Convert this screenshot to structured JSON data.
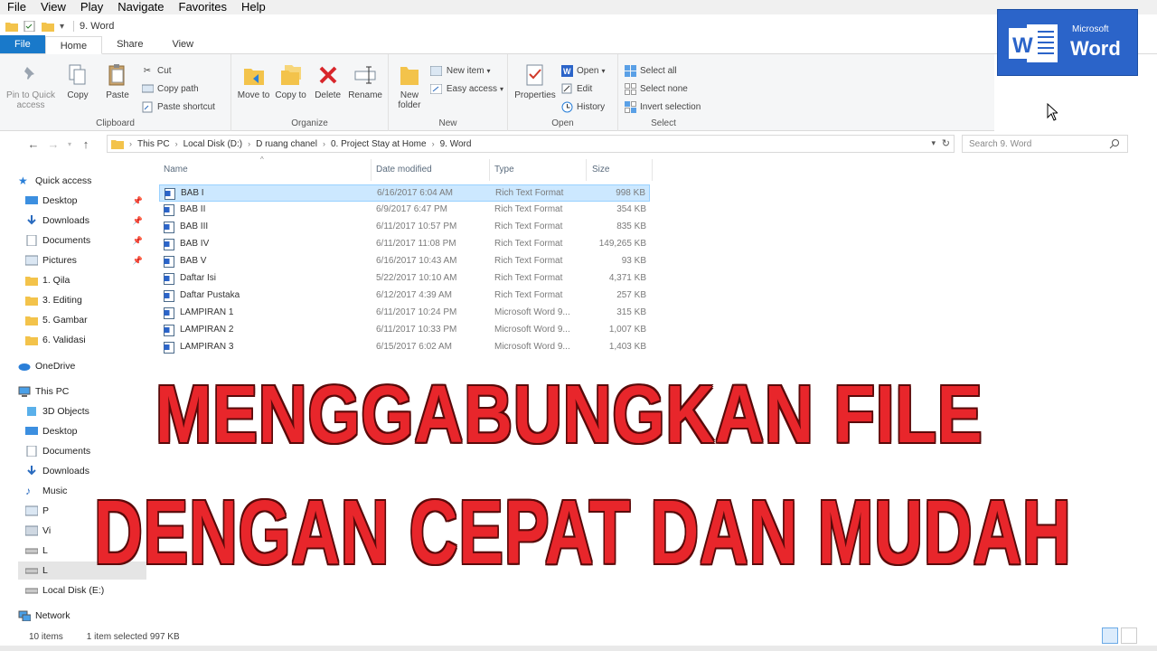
{
  "menubar": [
    "File",
    "View",
    "Play",
    "Navigate",
    "Favorites",
    "Help"
  ],
  "window_title": "9. Word",
  "tabs": [
    {
      "label": "File"
    },
    {
      "label": "Home"
    },
    {
      "label": "Share"
    },
    {
      "label": "View"
    }
  ],
  "ribbon": {
    "clipboard": {
      "label": "Clipboard",
      "pin": "Pin to Quick access",
      "copy": "Copy",
      "paste": "Paste",
      "cut": "Cut",
      "copy_path": "Copy path",
      "paste_shortcut": "Paste shortcut"
    },
    "organize": {
      "label": "Organize",
      "move_to": "Move to",
      "copy_to": "Copy to",
      "delete": "Delete",
      "rename": "Rename"
    },
    "new": {
      "label": "New",
      "new_folder": "New folder",
      "new_item": "New item",
      "easy_access": "Easy access"
    },
    "open": {
      "label": "Open",
      "properties": "Properties",
      "open": "Open",
      "edit": "Edit",
      "history": "History"
    },
    "select": {
      "label": "Select",
      "select_all": "Select all",
      "select_none": "Select none",
      "invert": "Invert selection"
    }
  },
  "logo": {
    "small": "Microsoft",
    "big": "Word"
  },
  "address": {
    "crumbs": [
      "This PC",
      "Local Disk (D:)",
      "D ruang chanel",
      "0. Project Stay at Home",
      "9. Word"
    ]
  },
  "search": {
    "placeholder": "Search 9. Word"
  },
  "nav": {
    "quick_access": "Quick access",
    "desktop": "Desktop",
    "downloads": "Downloads",
    "documents": "Documents",
    "pictures": "Pictures",
    "f1": "1. Qila",
    "f2": "3. Editing",
    "f3": "5. Gambar",
    "f4": "6. Validasi",
    "onedrive": "OneDrive",
    "thispc": "This PC",
    "objects3d": "3D Objects",
    "desktop2": "Desktop",
    "documents2": "Documents",
    "downloads2": "Downloads",
    "music": "Music",
    "pictures2": "P",
    "videos": "Vi",
    "diskc": "L",
    "diskd": "L",
    "diske": "Local Disk (E:)",
    "network": "Network"
  },
  "columns": {
    "name": "Name",
    "date": "Date modified",
    "type": "Type",
    "size": "Size"
  },
  "files": [
    {
      "name": "BAB I",
      "date": "6/16/2017 6:04 AM",
      "type": "Rich Text Format",
      "size": "998 KB"
    },
    {
      "name": "BAB II",
      "date": "6/9/2017 6:47 PM",
      "type": "Rich Text Format",
      "size": "354 KB"
    },
    {
      "name": "BAB III",
      "date": "6/11/2017 10:57 PM",
      "type": "Rich Text Format",
      "size": "835 KB"
    },
    {
      "name": "BAB IV",
      "date": "6/11/2017 11:08 PM",
      "type": "Rich Text Format",
      "size": "149,265 KB"
    },
    {
      "name": "BAB V",
      "date": "6/16/2017 10:43 AM",
      "type": "Rich Text Format",
      "size": "93 KB"
    },
    {
      "name": "Daftar Isi",
      "date": "5/22/2017 10:10 AM",
      "type": "Rich Text Format",
      "size": "4,371 KB"
    },
    {
      "name": "Daftar Pustaka",
      "date": "6/12/2017 4:39 AM",
      "type": "Rich Text Format",
      "size": "257 KB"
    },
    {
      "name": "LAMPIRAN 1",
      "date": "6/11/2017 10:24 PM",
      "type": "Microsoft Word 9...",
      "size": "315 KB"
    },
    {
      "name": "LAMPIRAN 2",
      "date": "6/11/2017 10:33 PM",
      "type": "Microsoft Word 9...",
      "size": "1,007 KB"
    },
    {
      "name": "LAMPIRAN 3",
      "date": "6/15/2017 6:02 AM",
      "type": "Microsoft Word 9...",
      "size": "1,403 KB"
    }
  ],
  "headline": {
    "line1": "MENGGABUNGKAN FILE",
    "line2": "DENGAN CEPAT DAN MUDAH"
  },
  "status": {
    "items": "10 items",
    "selected": "1 item selected  997 KB"
  },
  "colors": {
    "accent": "#1979ca",
    "word_blue": "#2b64c9",
    "headline_red": "#e8262b",
    "selection": "#cce8ff"
  }
}
